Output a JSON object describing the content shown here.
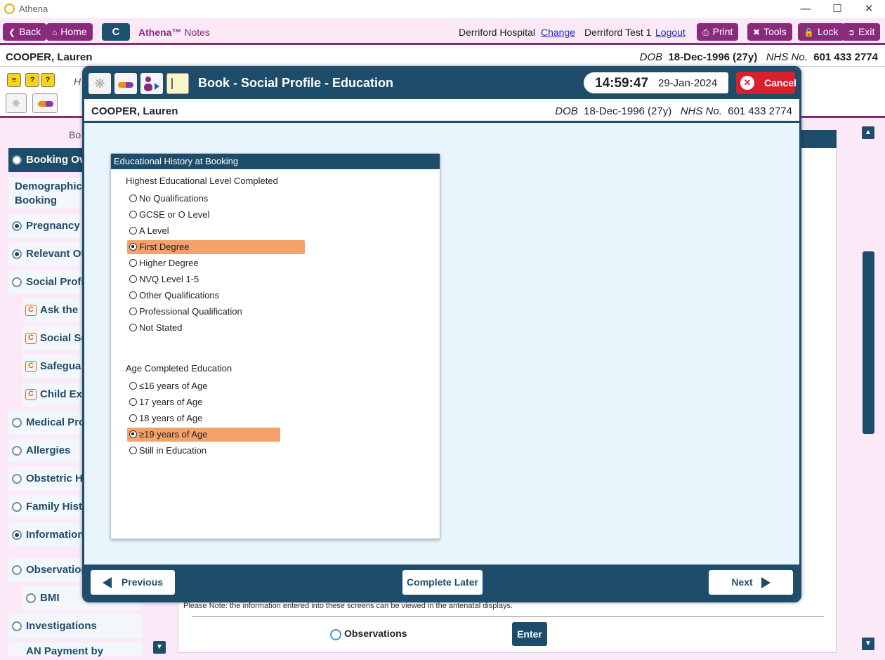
{
  "window": {
    "title": "Athena",
    "controls": [
      "—",
      "☐",
      "✕"
    ]
  },
  "toolbar": {
    "back": "Back",
    "home": "Home",
    "c": "C",
    "brand_name": "Athena™",
    "brand_suffix": "Notes",
    "hospital": "Derriford Hospital",
    "change": "Change",
    "user": "Derriford Test 1",
    "logout": "Logout",
    "print": "Print",
    "tools": "Tools",
    "lock": "Lock",
    "exit": "Exit"
  },
  "patient": {
    "name": "COOPER, Lauren",
    "dob_label": "DOB",
    "dob": "18-Dec-1996 (27y)",
    "nhs_label": "NHS No.",
    "nhs": "601 433 2774"
  },
  "background": {
    "tab_label": "Bo",
    "h_label": "H",
    "nav": [
      {
        "label": "Booking Ov",
        "type": "radio",
        "state": "off",
        "active": true
      },
      {
        "label": "Demographics\nBooking",
        "type": "text"
      },
      {
        "label": "Pregnancy I",
        "type": "radio",
        "state": "on"
      },
      {
        "label": "Relevant Ot",
        "type": "radio",
        "state": "on"
      },
      {
        "label": "Social Profil",
        "type": "radio",
        "state": "off"
      },
      {
        "label": "Ask the",
        "type": "c"
      },
      {
        "label": "Social Se",
        "type": "c"
      },
      {
        "label": "Safegua",
        "type": "c"
      },
      {
        "label": "Child Exp",
        "type": "c"
      },
      {
        "label": "Medical Pro",
        "type": "radio",
        "state": "off"
      },
      {
        "label": "Allergies",
        "type": "radio",
        "state": "off"
      },
      {
        "label": "Obstetric H",
        "type": "radio",
        "state": "off"
      },
      {
        "label": "Family Histo",
        "type": "radio",
        "state": "off"
      },
      {
        "label": "Information",
        "type": "radio",
        "state": "on"
      },
      {
        "label": "Observation",
        "type": "radio",
        "state": "off"
      },
      {
        "label": "BMI",
        "type": "radio",
        "state": "off"
      },
      {
        "label": "Investigations",
        "type": "radio",
        "state": "off"
      },
      {
        "label": "AN Payment by",
        "type": "text"
      }
    ],
    "note": "Please Note: the information entered into these screens can be viewed in the antenatal displays.",
    "observations": "Observations",
    "enter": "Enter"
  },
  "modal": {
    "title": "Book - Social Profile - Education",
    "time": "14:59:47",
    "date": "29-Jan-2024",
    "cancel": "Cancel",
    "card_title": "Educational History at Booking",
    "section1": "Highest Educational Level Completed",
    "level_options": [
      {
        "label": "No Qualifications",
        "selected": false
      },
      {
        "label": "GCSE or O Level",
        "selected": false
      },
      {
        "label": "A Level",
        "selected": false
      },
      {
        "label": "First Degree",
        "selected": true
      },
      {
        "label": "Higher Degree",
        "selected": false
      },
      {
        "label": "NVQ Level 1-5",
        "selected": false
      },
      {
        "label": "Other Qualifications",
        "selected": false
      },
      {
        "label": "Professional Qualification",
        "selected": false
      },
      {
        "label": "Not Stated",
        "selected": false
      }
    ],
    "section2": "Age Completed Education",
    "age_options": [
      {
        "label": "≤16 years of Age",
        "selected": false
      },
      {
        "label": "17 years of Age",
        "selected": false
      },
      {
        "label": "18 years of Age",
        "selected": false
      },
      {
        "label": "≥19 years of Age",
        "selected": true
      },
      {
        "label": "Still in Education",
        "selected": false
      }
    ],
    "previous": "Previous",
    "complete_later": "Complete Later",
    "next": "Next"
  },
  "colors": {
    "primary": "#1e4d6b",
    "brand": "#8a2a7c",
    "selected": "#f5a16a",
    "cancel": "#d8202a"
  }
}
